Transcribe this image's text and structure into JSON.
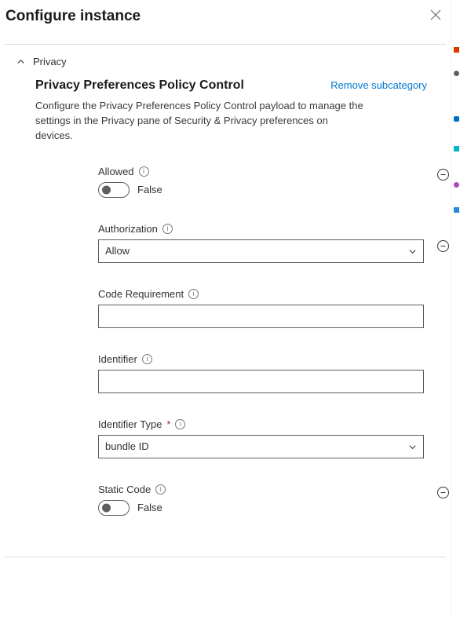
{
  "panel": {
    "title": "Configure instance"
  },
  "section": {
    "name": "Privacy",
    "expanded": true
  },
  "subcategory": {
    "title": "Privacy Preferences Policy Control",
    "remove_label": "Remove subcategory",
    "description": "Configure the Privacy Preferences Policy Control payload to manage the settings in the Privacy pane of Security & Privacy preferences on devices."
  },
  "fields": {
    "allowed": {
      "label": "Allowed",
      "value": false,
      "display": "False"
    },
    "authorization": {
      "label": "Authorization",
      "value": "Allow"
    },
    "code_requirement": {
      "label": "Code Requirement",
      "value": ""
    },
    "identifier": {
      "label": "Identifier",
      "value": ""
    },
    "identifier_type": {
      "label": "Identifier Type",
      "required": true,
      "value": "bundle ID"
    },
    "static_code": {
      "label": "Static Code",
      "value": false,
      "display": "False"
    }
  }
}
